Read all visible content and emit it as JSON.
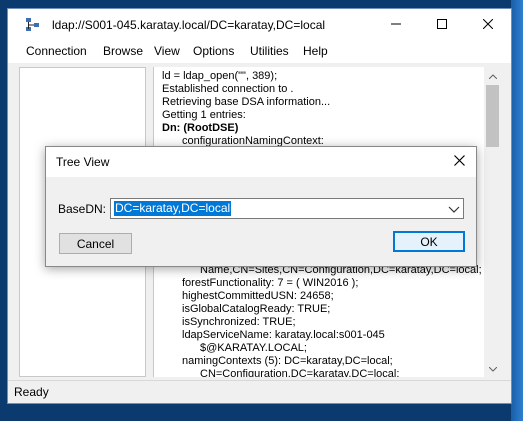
{
  "window": {
    "title": "ldap://S001-045.karatay.local/DC=karatay,DC=local",
    "icons": {
      "app": "network-tree-icon",
      "minimize": "minimize-icon",
      "maximize": "maximize-icon",
      "close": "close-icon"
    }
  },
  "menu": [
    "Connection",
    "Browse",
    "View",
    "Options",
    "Utilities",
    "Help"
  ],
  "output": {
    "lines_top": [
      "ld = ldap_open(\"\", 389);",
      "Established connection to .",
      "Retrieving base DSA information...",
      "Getting 1 entries:",
      "Dn: (RootDSE)",
      "configurationNamingContext:"
    ],
    "lines_bottom": [
      "Name,CN=Sites,CN=Configuration,DC=karatay,DC=local;",
      "forestFunctionality: 7 = ( WIN2016 );",
      "highestCommittedUSN: 24658;",
      "isGlobalCatalogReady: TRUE;",
      "isSynchronized: TRUE;",
      "ldapServiceName: karatay.local:s001-045",
      "$@KARATAY.LOCAL;",
      "namingContexts (5): DC=karatay,DC=local;",
      "CN=Configuration,DC=karatay,DC=local;"
    ]
  },
  "status": {
    "text": "Ready"
  },
  "dialog": {
    "title": "Tree View",
    "basedn_label": "BaseDN:",
    "basedn_value": "DC=karatay,DC=local",
    "cancel_label": "Cancel",
    "ok_label": "OK"
  },
  "colors": {
    "selection": "#0078d7",
    "desktop": "#0b3a6e",
    "default_button_border": "#0078d7"
  }
}
